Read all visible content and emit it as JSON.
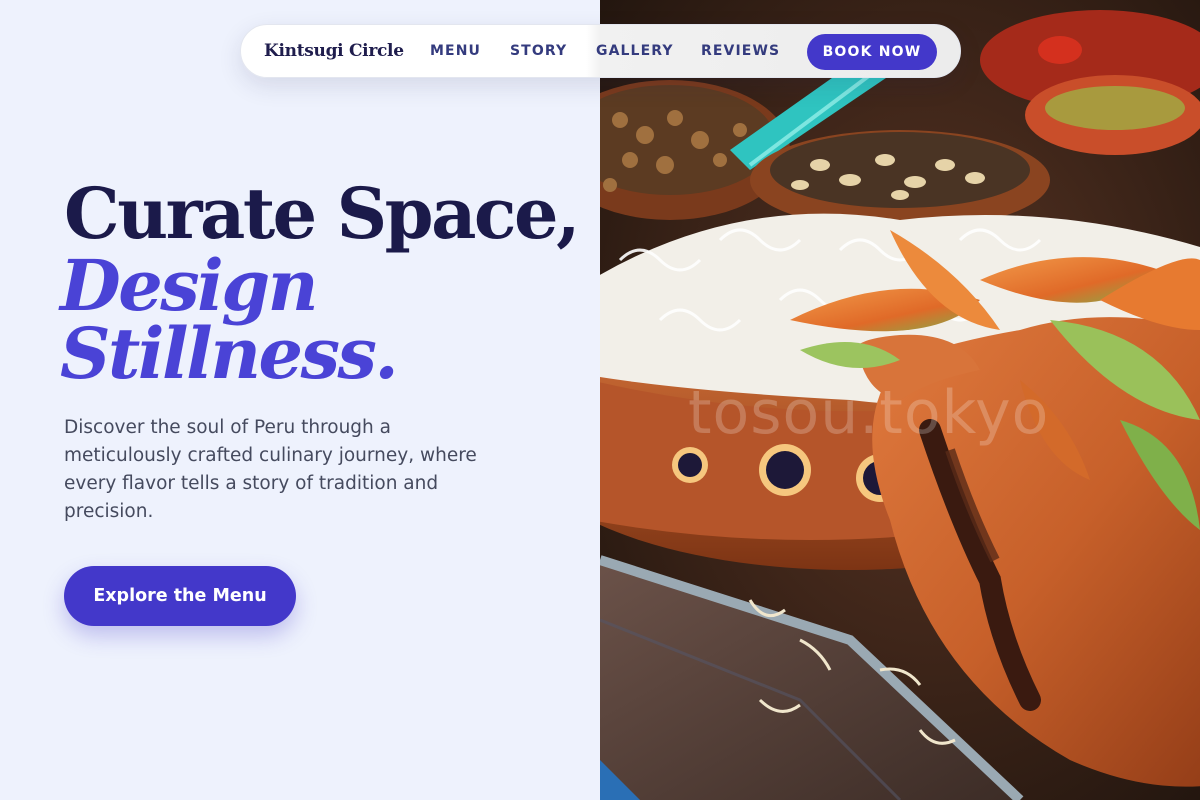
{
  "nav": {
    "brand": "Kintsugi Circle",
    "links": [
      "MENU",
      "STORY",
      "GALLERY",
      "REVIEWS"
    ],
    "cta": "BOOK NOW"
  },
  "hero": {
    "line1": "Curate Space,",
    "line2": "Design",
    "line3": "Stillness.",
    "description": "Discover the soul of Peru through a meticulously crafted culinary journey, where every flavor tells a story of tradition and precision.",
    "button": "Explore the Menu"
  },
  "image": {
    "watermark": "tosou.tokyo"
  },
  "colors": {
    "accent": "#4338ca",
    "heading_dark": "#1b1a4a",
    "heading_accent": "#4a43d6",
    "background": "#eef2fd"
  }
}
